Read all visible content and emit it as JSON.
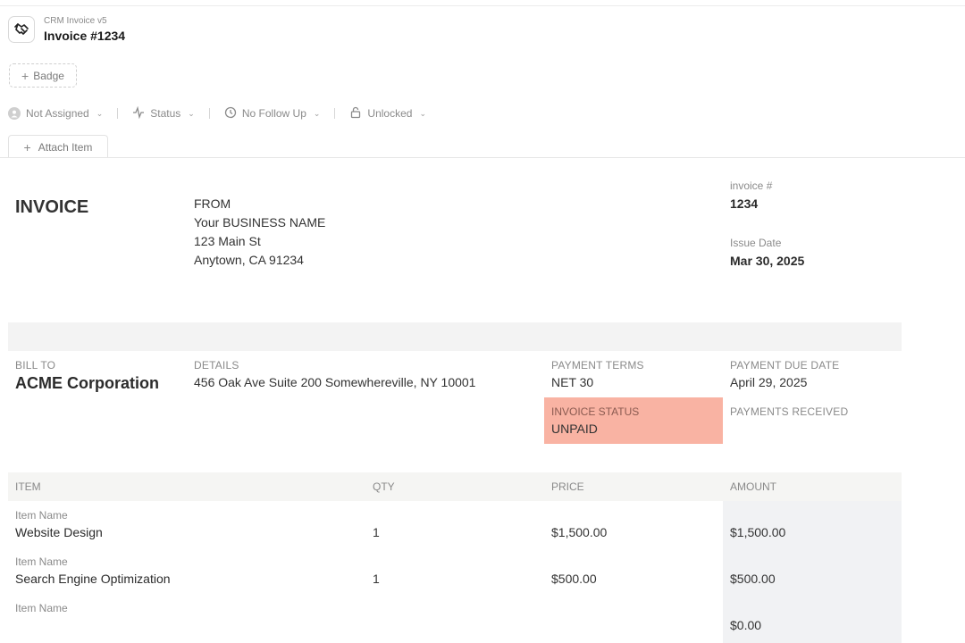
{
  "app": {
    "subtitle": "CRM Invoice v5",
    "title": "Invoice #1234",
    "logo_icon": "handshake-icon"
  },
  "toolbar": {
    "badge_label": "Badge",
    "assignee": "Not Assigned",
    "status": "Status",
    "follow_up": "No Follow Up",
    "lock": "Unlocked",
    "attach_label": "Attach Item"
  },
  "invoice": {
    "heading": "INVOICE",
    "from": {
      "label": "FROM",
      "name": "Your BUSINESS NAME",
      "street": "123 Main St",
      "city": "Anytown, CA 91234"
    },
    "number_label": "invoice #",
    "number": "1234",
    "issue_label": "Issue Date",
    "issue_date": "Mar 30, 2025",
    "bill_to_label": "BILL TO",
    "bill_to": "ACME Corporation",
    "details_label": "DETAILS",
    "details": "456 Oak Ave Suite 200 Somewhereville, NY 10001",
    "terms_label": "PAYMENT TERMS",
    "terms": "NET 30",
    "due_label": "PAYMENT DUE DATE",
    "due_date": "April 29, 2025",
    "status_label": "INVOICE STATUS",
    "status": "UNPAID",
    "status_color": "#f9b3a3",
    "received_label": "PAYMENTS RECEIVED"
  },
  "items": {
    "headers": [
      "ITEM",
      "QTY",
      "PRICE",
      "AMOUNT"
    ],
    "rows": [
      {
        "label": "Item Name",
        "name": "Website Design",
        "qty": "1",
        "price": "$1,500.00",
        "amount": "$1,500.00"
      },
      {
        "label": "Item Name",
        "name": "Search Engine Optimization",
        "qty": "1",
        "price": "$500.00",
        "amount": "$500.00"
      },
      {
        "label": "Item Name",
        "name": "",
        "qty": "",
        "price": "",
        "amount": "$0.00"
      }
    ]
  }
}
